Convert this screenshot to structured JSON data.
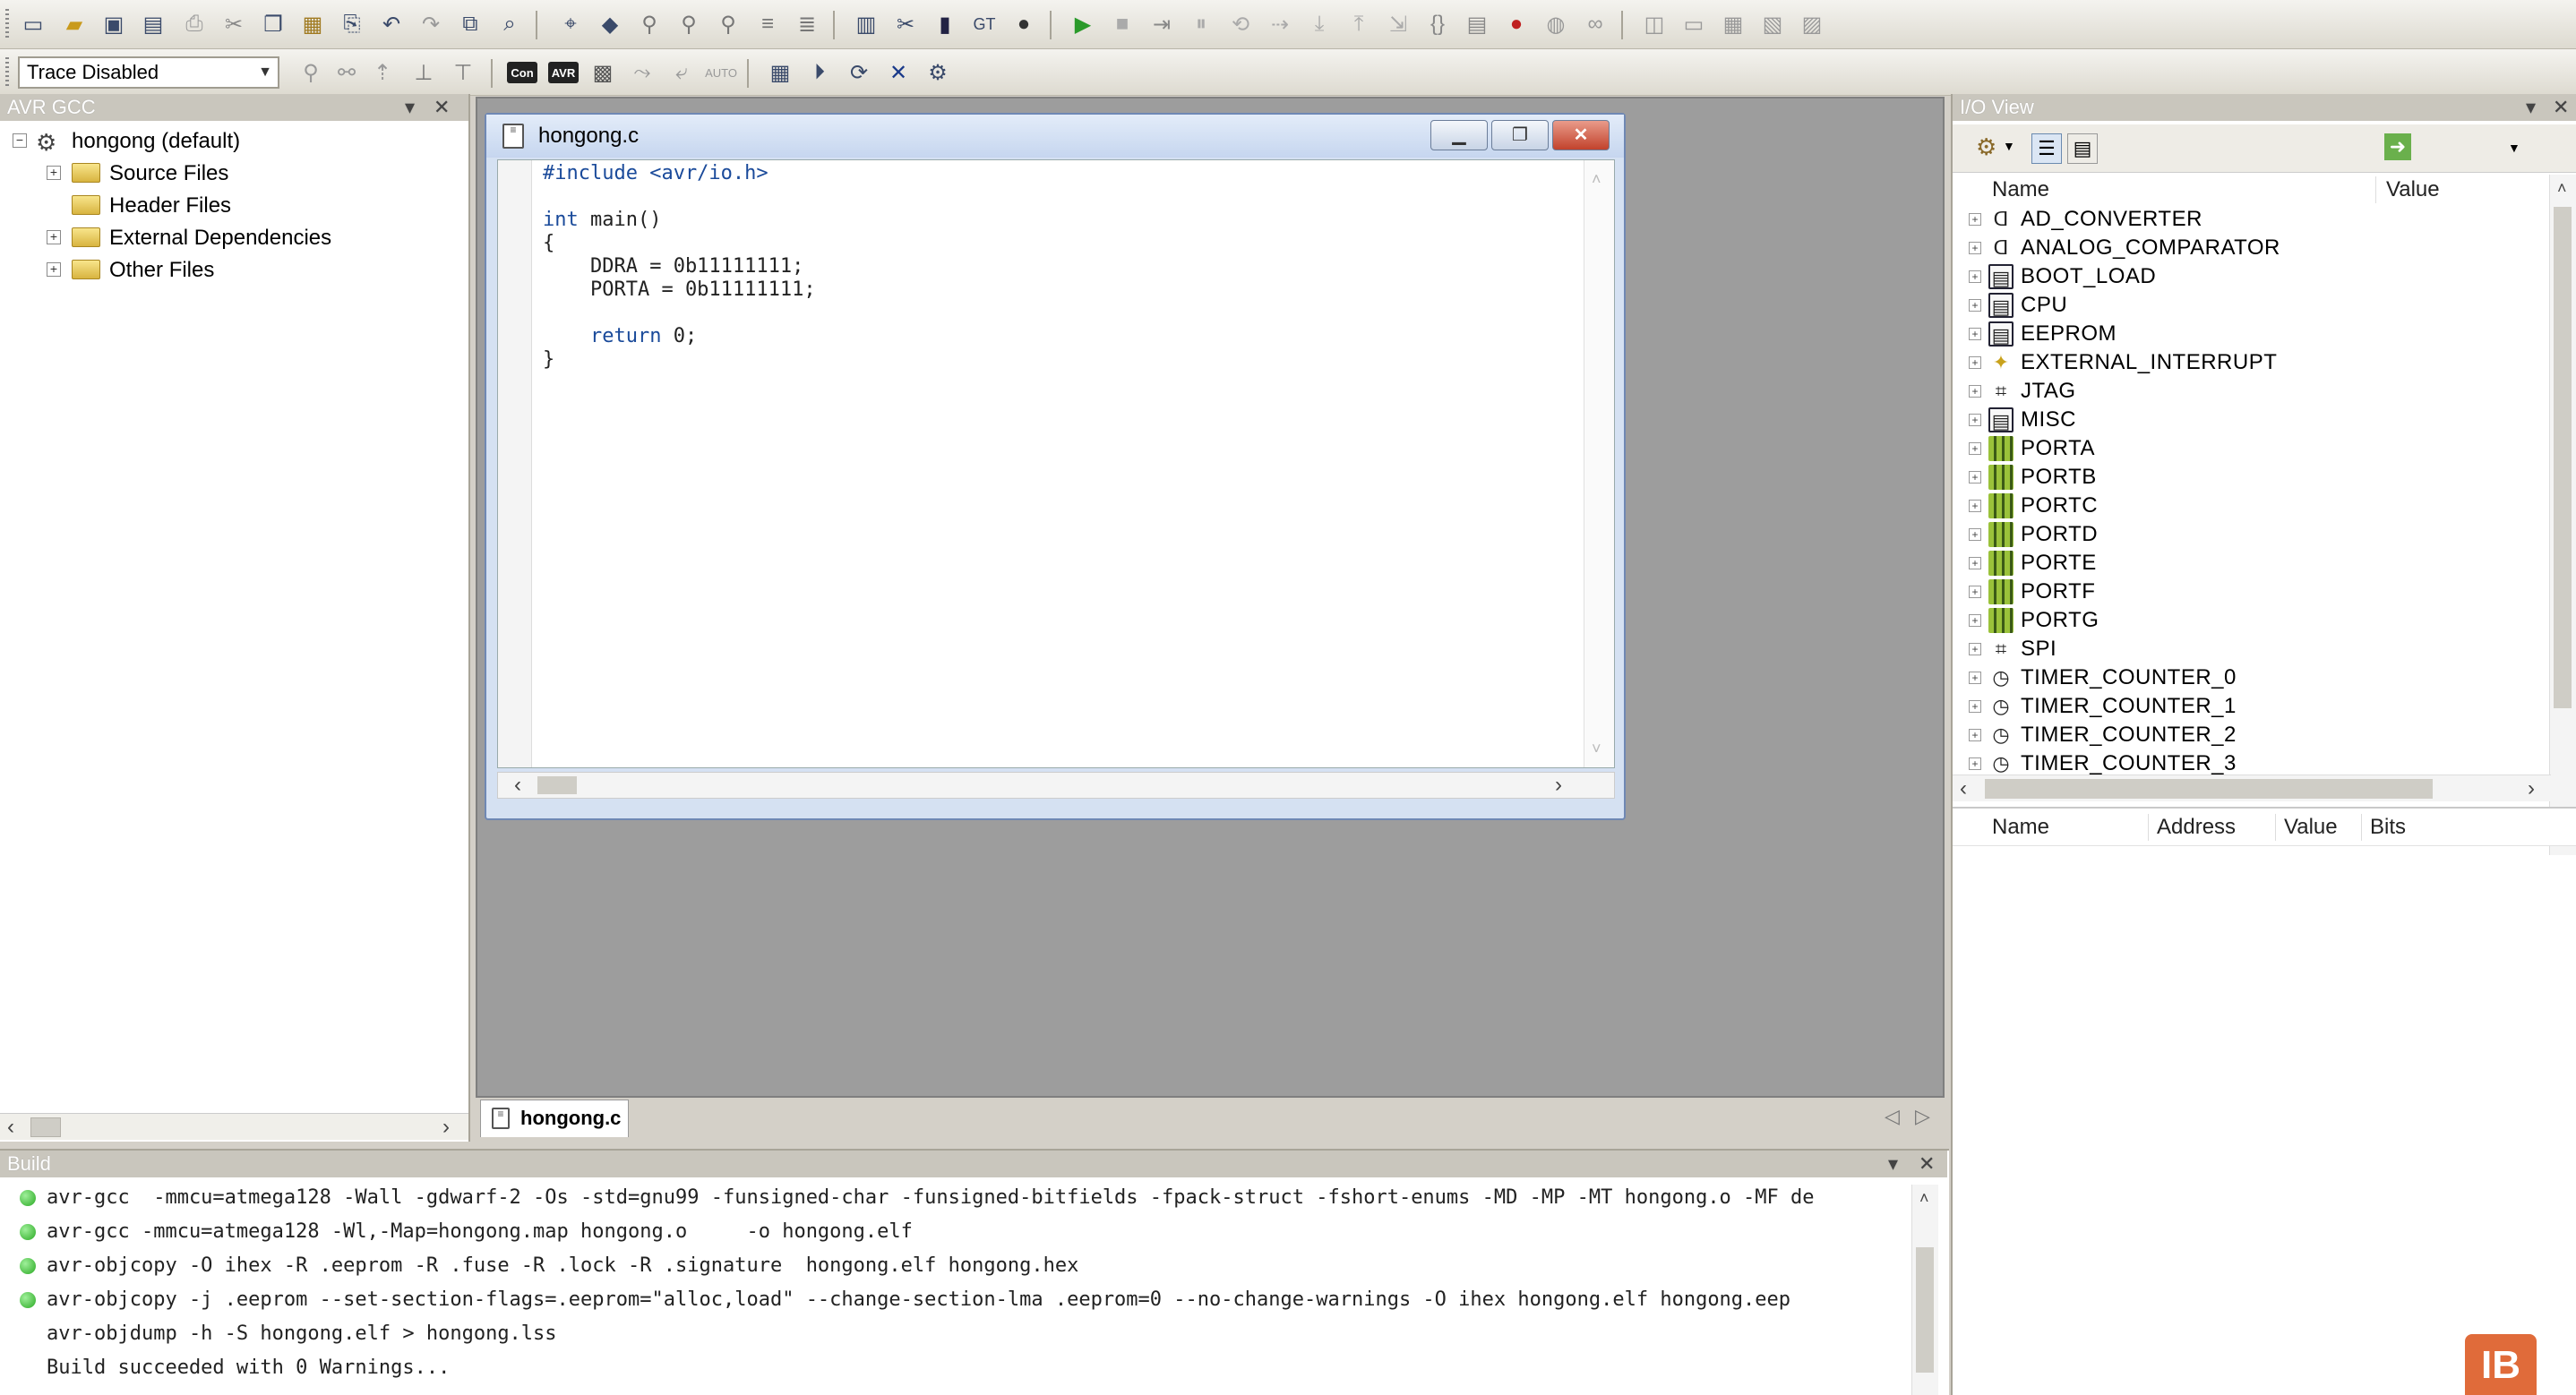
{
  "toolbar": {
    "trace_select_value": "Trace Disabled",
    "icons_row1": [
      "new-file-icon",
      "open-file-icon",
      "save-icon",
      "save-all-icon",
      "print-icon",
      "cut-icon",
      "copy-icon",
      "paste-icon",
      "undo-icon",
      "redo-icon",
      "find-icon",
      "build-icon",
      "compile-icon",
      "rebuild-icon",
      "run-icon",
      "stop-icon",
      "step-icon",
      "breakpoint-icon"
    ],
    "icons_row2": [
      "trace-icon",
      "con-icon",
      "avr-icon",
      "chip-icon",
      "settings-icon"
    ]
  },
  "project_panel": {
    "title": "AVR GCC",
    "root": "hongong (default)",
    "items": [
      {
        "label": "Source Files",
        "expandable": true
      },
      {
        "label": "Header Files",
        "expandable": false
      },
      {
        "label": "External Dependencies",
        "expandable": true
      },
      {
        "label": "Other Files",
        "expandable": true
      }
    ]
  },
  "editor": {
    "window_title": "hongong.c",
    "tab_label": "hongong.c",
    "code_lines": [
      "#include <avr/io.h>",
      "",
      "int main()",
      "{",
      "    DDRA = 0b11111111;",
      "    PORTA = 0b11111111;",
      "",
      "    return 0;",
      "}"
    ]
  },
  "io_view": {
    "title": "I/O View",
    "columns": {
      "name": "Name",
      "value": "Value"
    },
    "details_columns": {
      "name": "Name",
      "address": "Address",
      "value": "Value",
      "bits": "Bits"
    },
    "items": [
      {
        "label": "AD_CONVERTER",
        "icon": "adc-icon"
      },
      {
        "label": "ANALOG_COMPARATOR",
        "icon": "comparator-icon"
      },
      {
        "label": "BOOT_LOAD",
        "icon": "register-icon"
      },
      {
        "label": "CPU",
        "icon": "register-icon"
      },
      {
        "label": "EEPROM",
        "icon": "register-icon"
      },
      {
        "label": "EXTERNAL_INTERRUPT",
        "icon": "interrupt-icon"
      },
      {
        "label": "JTAG",
        "icon": "jtag-icon"
      },
      {
        "label": "MISC",
        "icon": "register-icon"
      },
      {
        "label": "PORTA",
        "icon": "port-icon"
      },
      {
        "label": "PORTB",
        "icon": "port-icon"
      },
      {
        "label": "PORTC",
        "icon": "port-icon"
      },
      {
        "label": "PORTD",
        "icon": "port-icon"
      },
      {
        "label": "PORTE",
        "icon": "port-icon"
      },
      {
        "label": "PORTF",
        "icon": "port-icon"
      },
      {
        "label": "PORTG",
        "icon": "port-icon"
      },
      {
        "label": "SPI",
        "icon": "spi-icon"
      },
      {
        "label": "TIMER_COUNTER_0",
        "icon": "timer-icon"
      },
      {
        "label": "TIMER_COUNTER_1",
        "icon": "timer-icon"
      },
      {
        "label": "TIMER_COUNTER_2",
        "icon": "timer-icon"
      },
      {
        "label": "TIMER_COUNTER_3",
        "icon": "timer-icon"
      }
    ]
  },
  "build_panel": {
    "title": "Build",
    "lines": [
      {
        "text": "avr-gcc  -mmcu=atmega128 -Wall -gdwarf-2 -Os -std=gnu99 -funsigned-char -funsigned-bitfields -fpack-struct -fshort-enums -MD -MP -MT hongong.o -MF de",
        "status": "ok"
      },
      {
        "text": "avr-gcc -mmcu=atmega128 -Wl,-Map=hongong.map hongong.o     -o hongong.elf",
        "status": "ok"
      },
      {
        "text": "avr-objcopy -O ihex -R .eeprom -R .fuse -R .lock -R .signature  hongong.elf hongong.hex",
        "status": "ok"
      },
      {
        "text": "avr-objcopy -j .eeprom --set-section-flags=.eeprom=\"alloc,load\" --change-section-lma .eeprom=0 --no-change-warnings -O ihex hongong.elf hongong.eep",
        "status": "ok"
      },
      {
        "text": "avr-objdump -h -S hongong.elf > hongong.lss",
        "status": "none"
      },
      {
        "text": "Build succeeded with 0 Warnings...",
        "status": "none"
      }
    ]
  },
  "colors": {
    "status_ok": "#29a822",
    "port_icon": "#9ac23a",
    "close_button": "#c2422c"
  }
}
